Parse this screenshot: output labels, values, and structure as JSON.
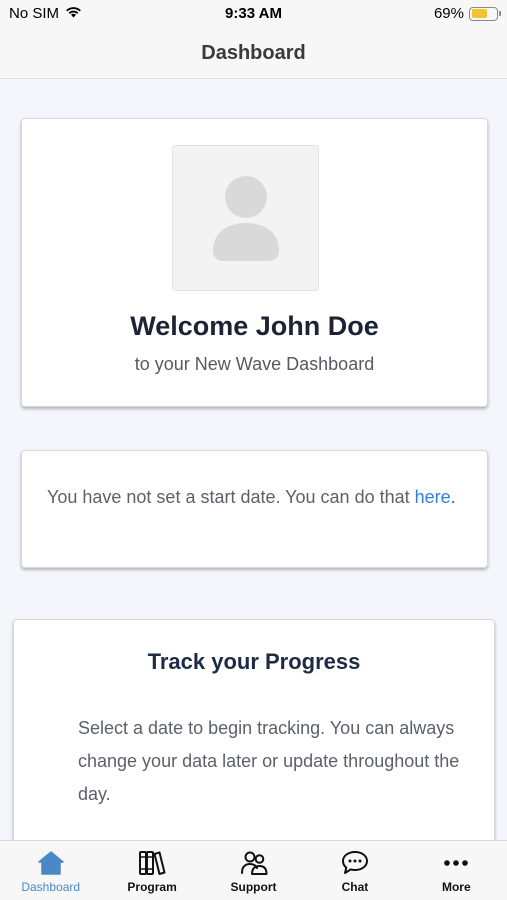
{
  "status_bar": {
    "carrier": "No SIM",
    "time": "9:33 AM",
    "battery_percent": "69%",
    "battery_level": 0.69,
    "battery_color": "#f2c230"
  },
  "header": {
    "title": "Dashboard"
  },
  "welcome": {
    "avatar_icon": "user-placeholder-icon",
    "title": "Welcome John Doe",
    "subtitle": "to your New Wave Dashboard"
  },
  "start_date": {
    "text": "You have not set a start date. You can do that ",
    "link_label": "here",
    "suffix": "."
  },
  "progress": {
    "title": "Track your Progress",
    "text": "Select a date to begin tracking. You can always change your data later or update throughout the day."
  },
  "tabs": [
    {
      "label": "Dashboard",
      "icon": "home-icon",
      "active": true
    },
    {
      "label": "Program",
      "icon": "books-icon",
      "active": false
    },
    {
      "label": "Support",
      "icon": "people-icon",
      "active": false
    },
    {
      "label": "Chat",
      "icon": "chat-bubble-icon",
      "active": false
    },
    {
      "label": "More",
      "icon": "more-dots-icon",
      "active": false
    }
  ],
  "colors": {
    "accent": "#4a88c8",
    "link": "#2f7fdc"
  }
}
